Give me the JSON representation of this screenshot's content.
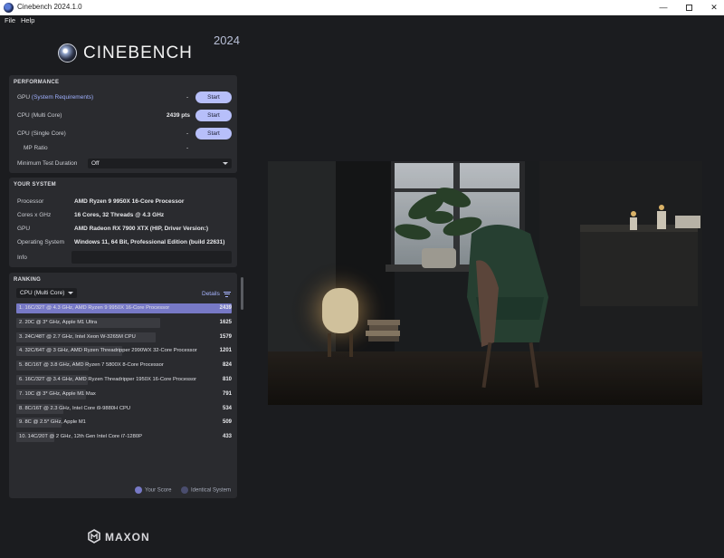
{
  "window": {
    "title": "Cinebench 2024.1.0",
    "controls": {
      "minimize": "—",
      "maximize": "",
      "close": "✕"
    }
  },
  "menu": [
    "File",
    "Help"
  ],
  "brand": {
    "name": "CINEBENCH",
    "year": "2024",
    "footer": "MAXON"
  },
  "performance": {
    "title": "PERFORMANCE",
    "start_label": "Start",
    "gpu": {
      "label": "GPU",
      "link": "(System Requirements)",
      "value": "-"
    },
    "cpu_multi": {
      "label": "CPU (Multi Core)",
      "value": "2439 pts"
    },
    "cpu_single": {
      "label": "CPU (Single Core)",
      "value": "-"
    },
    "mp_ratio": {
      "label": "MP Ratio",
      "value": "-"
    },
    "min_duration": {
      "label": "Minimum Test Duration",
      "value": "Off"
    }
  },
  "system": {
    "title": "YOUR SYSTEM",
    "processor": {
      "label": "Processor",
      "value": "AMD Ryzen 9 9950X 16-Core Processor"
    },
    "cores": {
      "label": "Cores x GHz",
      "value": "16 Cores, 32 Threads @ 4.3 GHz"
    },
    "gpu": {
      "label": "GPU",
      "value": "AMD Radeon RX 7900 XTX (HIP, Driver Version:)"
    },
    "os": {
      "label": "Operating System",
      "value": "Windows 11, 64 Bit, Professional Edition (build 22631)"
    },
    "info": {
      "label": "Info",
      "value": ""
    }
  },
  "ranking": {
    "title": "RANKING",
    "selector": "CPU (Multi Core)",
    "details_label": "Details",
    "rows": [
      {
        "label": "1. 16C/32T @ 4.3 GHz, AMD Ryzen 9 9950X 16-Core Processor",
        "score": "2439",
        "fraction": 1.0,
        "highlight": true
      },
      {
        "label": "2. 20C @ 3* GHz, Apple M1 Ultra",
        "score": "1625",
        "fraction": 0.666,
        "highlight": false
      },
      {
        "label": "3. 24C/48T @ 2.7 GHz, Intel Xeon W-3265M CPU",
        "score": "1579",
        "fraction": 0.647,
        "highlight": false
      },
      {
        "label": "4. 32C/64T @ 3 GHz, AMD Ryzen Threadripper 2990WX 32-Core Processor",
        "score": "1201",
        "fraction": 0.492,
        "highlight": false
      },
      {
        "label": "5. 8C/16T @ 3.8 GHz, AMD Ryzen 7 5800X 8-Core Processor",
        "score": "824",
        "fraction": 0.338,
        "highlight": false
      },
      {
        "label": "6. 16C/32T @ 3.4 GHz, AMD Ryzen Threadripper 1950X 16-Core Processor",
        "score": "810",
        "fraction": 0.332,
        "highlight": false
      },
      {
        "label": "7. 10C @ 3* GHz, Apple M1 Max",
        "score": "791",
        "fraction": 0.324,
        "highlight": false
      },
      {
        "label": "8. 8C/16T @ 2.3 GHz, Intel Core i9-9880H CPU",
        "score": "534",
        "fraction": 0.219,
        "highlight": false
      },
      {
        "label": "9. 8C @ 2.5* GHz, Apple M1",
        "score": "509",
        "fraction": 0.209,
        "highlight": false
      },
      {
        "label": "10. 14C/20T @ 2 GHz, 12th Gen Intel Core i7-1280P",
        "score": "433",
        "fraction": 0.178,
        "highlight": false
      }
    ],
    "legend": {
      "your_score": "Your Score",
      "identical": "Identical System"
    }
  },
  "colors": {
    "accent": "#b7bffa",
    "highlight_bar": "#7779c6",
    "your_score_dot": "#7779c6",
    "identical_dot": "#4a4d6e"
  }
}
